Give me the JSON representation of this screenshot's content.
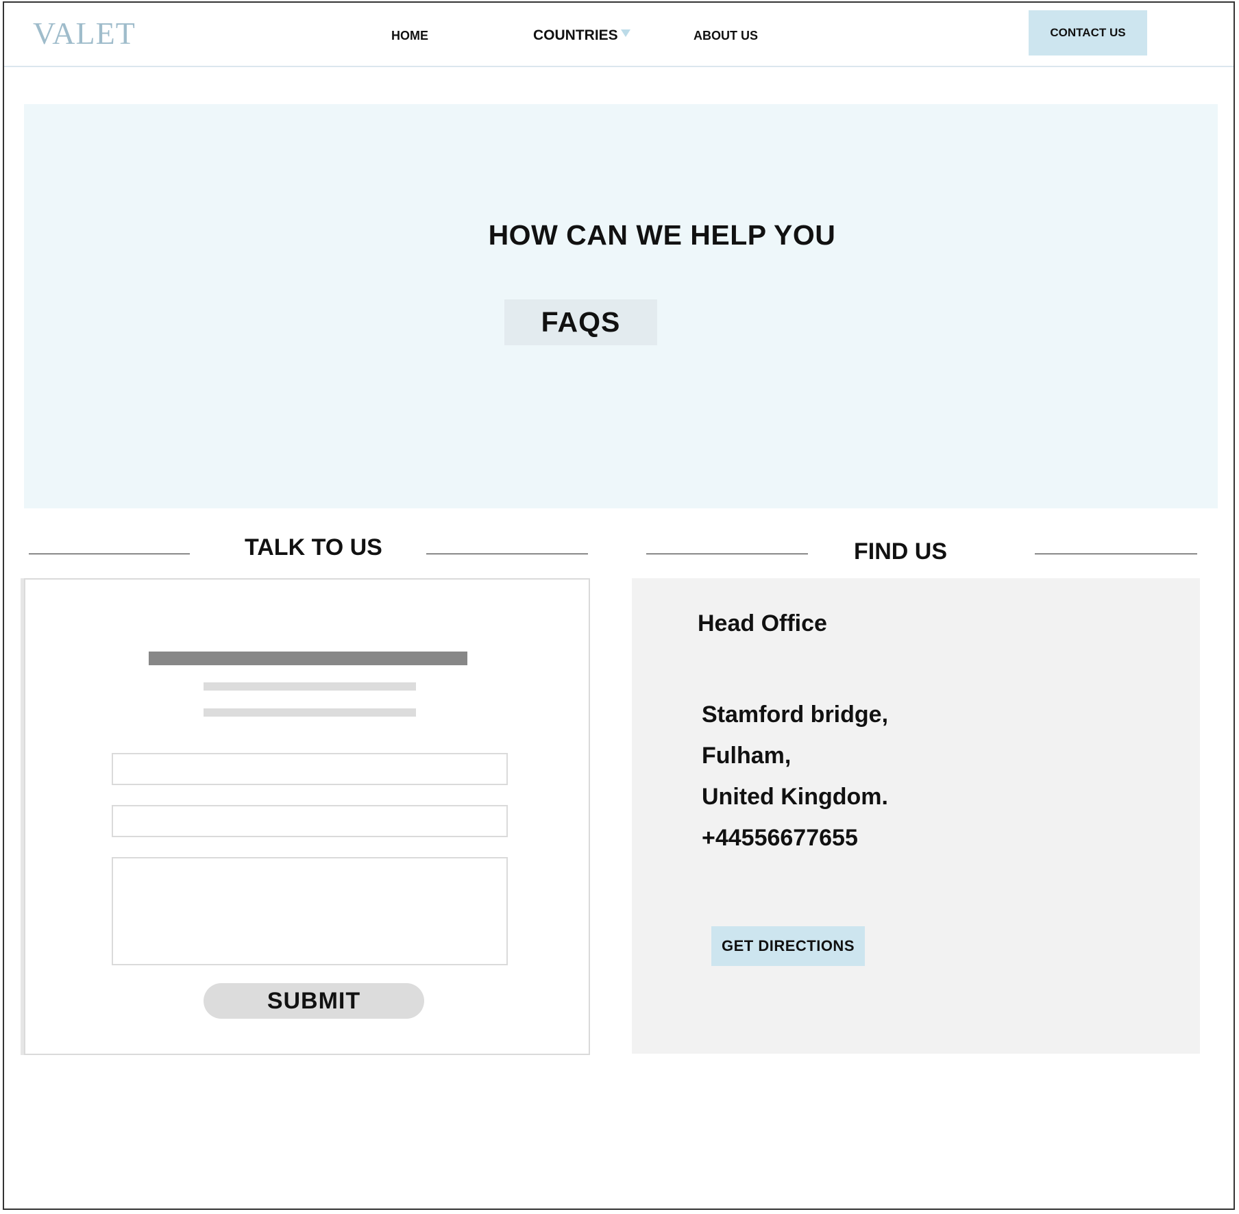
{
  "header": {
    "logo": "VALET",
    "nav": {
      "home": "HOME",
      "countries": "COUNTRIES",
      "about": "ABOUT US"
    },
    "contact_button": "CONTACT US"
  },
  "hero": {
    "title": "HOW CAN WE HELP YOU",
    "faq_button": "FAQS"
  },
  "talk": {
    "title": "TALK TO US",
    "name_field": {
      "value": "",
      "placeholder": ""
    },
    "email_field": {
      "value": "",
      "placeholder": ""
    },
    "message_field": {
      "value": "",
      "placeholder": ""
    },
    "submit_button": "SUBMIT"
  },
  "find": {
    "title": "FIND US",
    "office_label": "Head Office",
    "address_lines": [
      "Stamford bridge,",
      "Fulham,",
      "United Kingdom.",
      "+44556677655"
    ],
    "directions_button": "GET DIRECTIONS"
  },
  "colors": {
    "accent": "#cde5ef",
    "hero_bg": "#eef7fa",
    "logo": "#9fbccb",
    "panel_bg": "#f2f2f2"
  }
}
